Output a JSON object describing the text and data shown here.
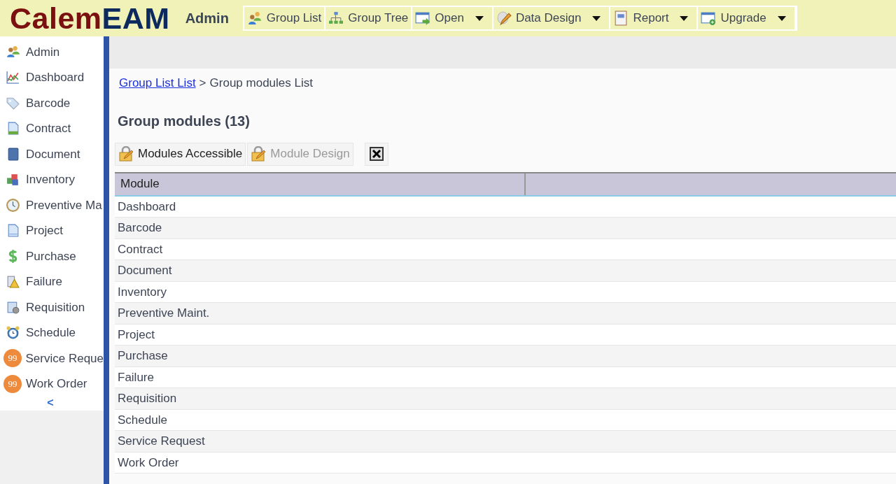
{
  "header": {
    "logo_left": "Calem",
    "logo_right": "EAM",
    "section": "Admin",
    "toolbar": [
      {
        "label": "Group List",
        "has_menu": false
      },
      {
        "label": "Group Tree",
        "has_menu": false
      },
      {
        "label": "Open",
        "has_menu": true
      },
      {
        "label": "Data Design",
        "has_menu": true
      },
      {
        "label": "Report",
        "has_menu": true
      },
      {
        "label": "Upgrade",
        "has_menu": true
      }
    ]
  },
  "sidebar": {
    "items": [
      {
        "label": "Admin"
      },
      {
        "label": "Dashboard"
      },
      {
        "label": "Barcode"
      },
      {
        "label": "Contract"
      },
      {
        "label": "Document"
      },
      {
        "label": "Inventory"
      },
      {
        "label": "Preventive Ma"
      },
      {
        "label": "Project"
      },
      {
        "label": "Purchase"
      },
      {
        "label": "Failure"
      },
      {
        "label": "Requisition"
      },
      {
        "label": "Schedule"
      },
      {
        "label": "Service Reque",
        "badge": "99"
      },
      {
        "label": "Work Order",
        "badge": "99"
      }
    ],
    "collapse": "<"
  },
  "breadcrumb": {
    "link": "Group List List",
    "separator": ">",
    "current": "Group modules List"
  },
  "title": "Group modules (13)",
  "actions": [
    {
      "label": "Modules Accessible",
      "disabled": false
    },
    {
      "label": "Module Design",
      "disabled": true
    }
  ],
  "table": {
    "columns": [
      "Module"
    ],
    "rows": [
      "Dashboard",
      "Barcode",
      "Contract",
      "Document",
      "Inventory",
      "Preventive Maint.",
      "Project",
      "Purchase",
      "Failure",
      "Requisition",
      "Schedule",
      "Service Request",
      "Work Order"
    ]
  }
}
